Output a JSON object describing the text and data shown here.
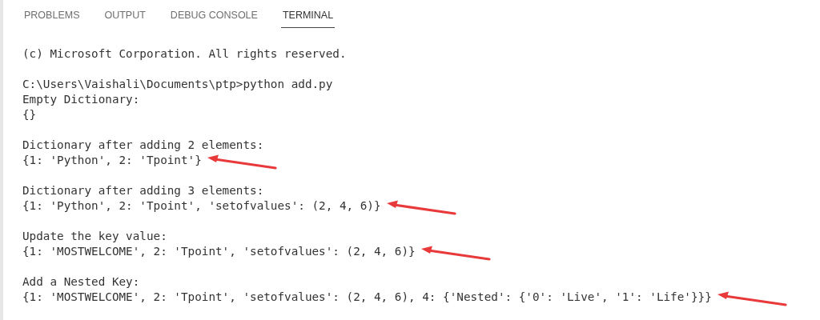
{
  "tabs": [
    {
      "label": "PROBLEMS",
      "selected": false
    },
    {
      "label": "OUTPUT",
      "selected": false
    },
    {
      "label": "DEBUG CONSOLE",
      "selected": false
    },
    {
      "label": "TERMINAL",
      "selected": true
    }
  ],
  "terminal": {
    "blocks": [
      [
        {
          "text": "(c) Microsoft Corporation. All rights reserved.",
          "arrow": false
        }
      ],
      [
        {
          "text": "C:\\Users\\Vaishali\\Documents\\ptp>python add.py",
          "arrow": false
        },
        {
          "text": "Empty Dictionary:",
          "arrow": false
        },
        {
          "text": "{}",
          "arrow": false
        }
      ],
      [
        {
          "text": "Dictionary after adding 2 elements:",
          "arrow": false
        },
        {
          "text": "{1: 'Python', 2: 'Tpoint'}",
          "arrow": true
        }
      ],
      [
        {
          "text": "Dictionary after adding 3 elements:",
          "arrow": false
        },
        {
          "text": "{1: 'Python', 2: 'Tpoint', 'setofvalues': (2, 4, 6)}",
          "arrow": true
        }
      ],
      [
        {
          "text": "Update the key value:",
          "arrow": false
        },
        {
          "text": "{1: 'MOSTWELCOME', 2: 'Tpoint', 'setofvalues': (2, 4, 6)}",
          "arrow": true
        }
      ],
      [
        {
          "text": "Add a Nested Key:",
          "arrow": false
        },
        {
          "text": "{1: 'MOSTWELCOME', 2: 'Tpoint', 'setofvalues': (2, 4, 6), 4: {'Nested': {'0': 'Live', '1': 'Life'}}}",
          "arrow": true
        }
      ]
    ]
  }
}
